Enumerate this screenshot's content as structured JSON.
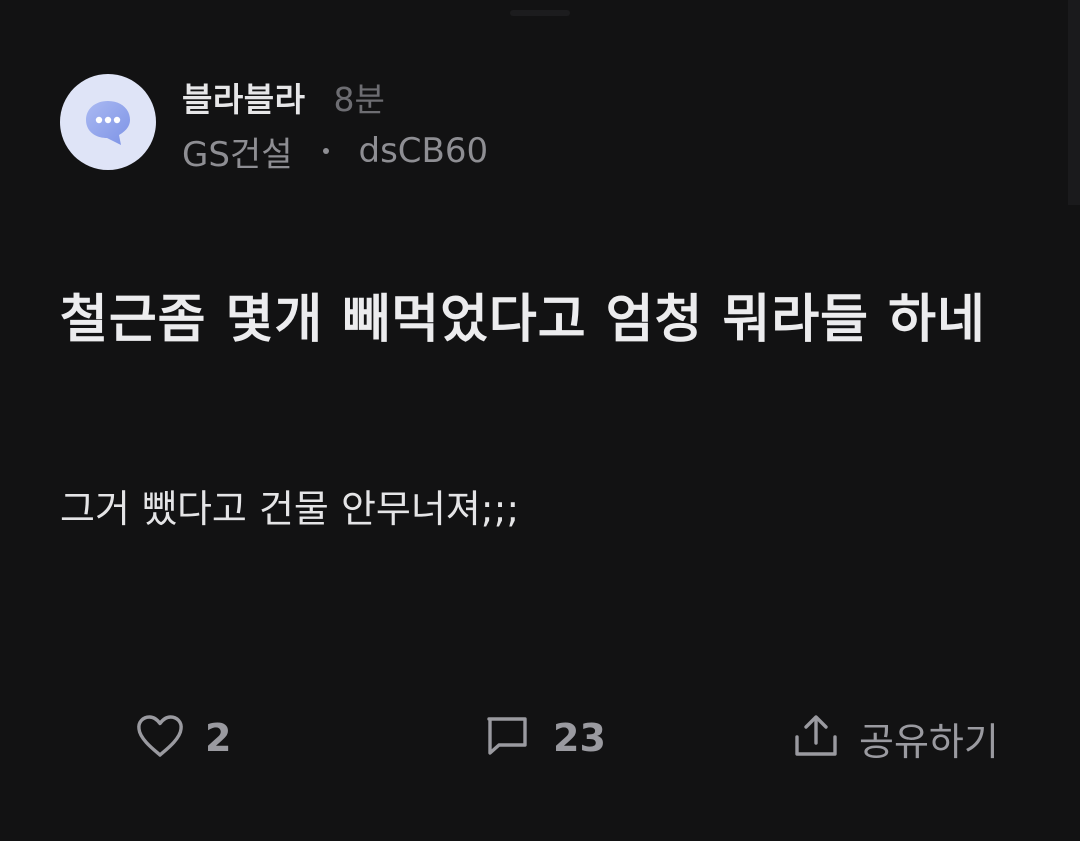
{
  "post": {
    "author": "블라블라",
    "time": "8분",
    "company": "GS건설",
    "user_id": "dsCB60",
    "title": "철근좀 몇개 빼먹었다고 엄청 뭐라들 하네",
    "body": "그거 뺐다고 건물 안무너져;;;"
  },
  "actions": {
    "like_count": "2",
    "comment_count": "23",
    "share_label": "공유하기"
  },
  "icons": {
    "avatar": "chat-bubble-icon",
    "like": "heart-icon",
    "comment": "comment-icon",
    "share": "share-icon"
  },
  "colors": {
    "background": "#121213",
    "avatar_bg": "#dfe4f7",
    "avatar_bubble": "#8fa3ea",
    "muted_text": "#8e8e93",
    "action_text": "#9a9aa0"
  }
}
